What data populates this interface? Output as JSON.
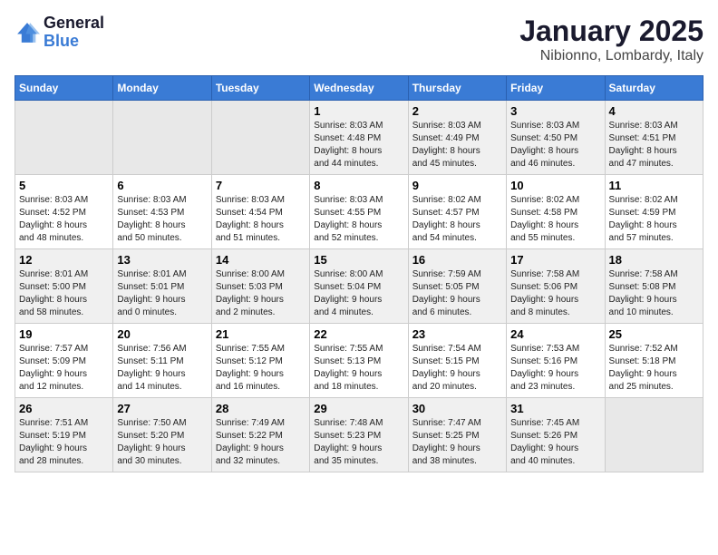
{
  "logo": {
    "line1": "General",
    "line2": "Blue"
  },
  "title": "January 2025",
  "location": "Nibionno, Lombardy, Italy",
  "weekdays": [
    "Sunday",
    "Monday",
    "Tuesday",
    "Wednesday",
    "Thursday",
    "Friday",
    "Saturday"
  ],
  "weeks": [
    [
      {
        "day": "",
        "info": ""
      },
      {
        "day": "",
        "info": ""
      },
      {
        "day": "",
        "info": ""
      },
      {
        "day": "1",
        "info": "Sunrise: 8:03 AM\nSunset: 4:48 PM\nDaylight: 8 hours\nand 44 minutes."
      },
      {
        "day": "2",
        "info": "Sunrise: 8:03 AM\nSunset: 4:49 PM\nDaylight: 8 hours\nand 45 minutes."
      },
      {
        "day": "3",
        "info": "Sunrise: 8:03 AM\nSunset: 4:50 PM\nDaylight: 8 hours\nand 46 minutes."
      },
      {
        "day": "4",
        "info": "Sunrise: 8:03 AM\nSunset: 4:51 PM\nDaylight: 8 hours\nand 47 minutes."
      }
    ],
    [
      {
        "day": "5",
        "info": "Sunrise: 8:03 AM\nSunset: 4:52 PM\nDaylight: 8 hours\nand 48 minutes."
      },
      {
        "day": "6",
        "info": "Sunrise: 8:03 AM\nSunset: 4:53 PM\nDaylight: 8 hours\nand 50 minutes."
      },
      {
        "day": "7",
        "info": "Sunrise: 8:03 AM\nSunset: 4:54 PM\nDaylight: 8 hours\nand 51 minutes."
      },
      {
        "day": "8",
        "info": "Sunrise: 8:03 AM\nSunset: 4:55 PM\nDaylight: 8 hours\nand 52 minutes."
      },
      {
        "day": "9",
        "info": "Sunrise: 8:02 AM\nSunset: 4:57 PM\nDaylight: 8 hours\nand 54 minutes."
      },
      {
        "day": "10",
        "info": "Sunrise: 8:02 AM\nSunset: 4:58 PM\nDaylight: 8 hours\nand 55 minutes."
      },
      {
        "day": "11",
        "info": "Sunrise: 8:02 AM\nSunset: 4:59 PM\nDaylight: 8 hours\nand 57 minutes."
      }
    ],
    [
      {
        "day": "12",
        "info": "Sunrise: 8:01 AM\nSunset: 5:00 PM\nDaylight: 8 hours\nand 58 minutes."
      },
      {
        "day": "13",
        "info": "Sunrise: 8:01 AM\nSunset: 5:01 PM\nDaylight: 9 hours\nand 0 minutes."
      },
      {
        "day": "14",
        "info": "Sunrise: 8:00 AM\nSunset: 5:03 PM\nDaylight: 9 hours\nand 2 minutes."
      },
      {
        "day": "15",
        "info": "Sunrise: 8:00 AM\nSunset: 5:04 PM\nDaylight: 9 hours\nand 4 minutes."
      },
      {
        "day": "16",
        "info": "Sunrise: 7:59 AM\nSunset: 5:05 PM\nDaylight: 9 hours\nand 6 minutes."
      },
      {
        "day": "17",
        "info": "Sunrise: 7:58 AM\nSunset: 5:06 PM\nDaylight: 9 hours\nand 8 minutes."
      },
      {
        "day": "18",
        "info": "Sunrise: 7:58 AM\nSunset: 5:08 PM\nDaylight: 9 hours\nand 10 minutes."
      }
    ],
    [
      {
        "day": "19",
        "info": "Sunrise: 7:57 AM\nSunset: 5:09 PM\nDaylight: 9 hours\nand 12 minutes."
      },
      {
        "day": "20",
        "info": "Sunrise: 7:56 AM\nSunset: 5:11 PM\nDaylight: 9 hours\nand 14 minutes."
      },
      {
        "day": "21",
        "info": "Sunrise: 7:55 AM\nSunset: 5:12 PM\nDaylight: 9 hours\nand 16 minutes."
      },
      {
        "day": "22",
        "info": "Sunrise: 7:55 AM\nSunset: 5:13 PM\nDaylight: 9 hours\nand 18 minutes."
      },
      {
        "day": "23",
        "info": "Sunrise: 7:54 AM\nSunset: 5:15 PM\nDaylight: 9 hours\nand 20 minutes."
      },
      {
        "day": "24",
        "info": "Sunrise: 7:53 AM\nSunset: 5:16 PM\nDaylight: 9 hours\nand 23 minutes."
      },
      {
        "day": "25",
        "info": "Sunrise: 7:52 AM\nSunset: 5:18 PM\nDaylight: 9 hours\nand 25 minutes."
      }
    ],
    [
      {
        "day": "26",
        "info": "Sunrise: 7:51 AM\nSunset: 5:19 PM\nDaylight: 9 hours\nand 28 minutes."
      },
      {
        "day": "27",
        "info": "Sunrise: 7:50 AM\nSunset: 5:20 PM\nDaylight: 9 hours\nand 30 minutes."
      },
      {
        "day": "28",
        "info": "Sunrise: 7:49 AM\nSunset: 5:22 PM\nDaylight: 9 hours\nand 32 minutes."
      },
      {
        "day": "29",
        "info": "Sunrise: 7:48 AM\nSunset: 5:23 PM\nDaylight: 9 hours\nand 35 minutes."
      },
      {
        "day": "30",
        "info": "Sunrise: 7:47 AM\nSunset: 5:25 PM\nDaylight: 9 hours\nand 38 minutes."
      },
      {
        "day": "31",
        "info": "Sunrise: 7:45 AM\nSunset: 5:26 PM\nDaylight: 9 hours\nand 40 minutes."
      },
      {
        "day": "",
        "info": ""
      }
    ]
  ]
}
